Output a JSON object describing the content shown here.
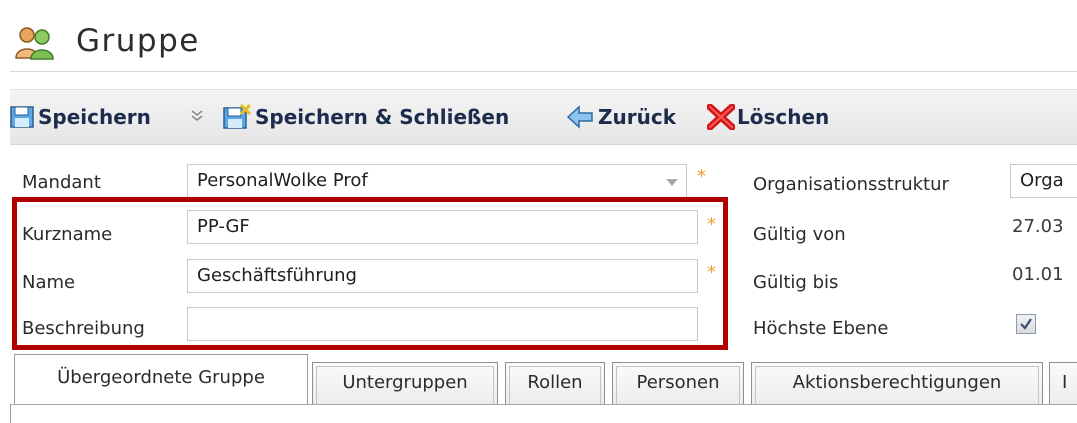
{
  "window": {
    "title": "Gruppe",
    "title_icon": "group-users-icon"
  },
  "toolbar": {
    "save_label": "Speichern",
    "save_close_label": "Speichern & Schließen",
    "back_label": "Zurück",
    "delete_label": "Löschen"
  },
  "form": {
    "mandant": {
      "label": "Mandant",
      "value": "PersonalWolke Prof"
    },
    "kurzname": {
      "label": "Kurzname",
      "value": "PP-GF"
    },
    "name": {
      "label": "Name",
      "value": "Geschäftsführung"
    },
    "beschreibung": {
      "label": "Beschreibung",
      "value": ""
    },
    "organisationsstruktur": {
      "label": "Organisationsstruktur",
      "value": "Orga"
    },
    "gueltig_von": {
      "label": "Gültig von",
      "value": "27.03"
    },
    "gueltig_bis": {
      "label": "Gültig bis",
      "value": "01.01"
    },
    "hoechste_ebene": {
      "label": "Höchste Ebene",
      "checked": true
    },
    "required_marker": "*"
  },
  "tabs": [
    {
      "label": "Übergeordnete Gruppe",
      "active": true
    },
    {
      "label": "Untergruppen"
    },
    {
      "label": "Rollen"
    },
    {
      "label": "Personen"
    },
    {
      "label": "Aktionsberechtigungen"
    },
    {
      "label": "I"
    }
  ],
  "colors": {
    "highlight": "#b00000",
    "required": "#f39a2a",
    "toolbar_text": "#1d2c4c"
  }
}
